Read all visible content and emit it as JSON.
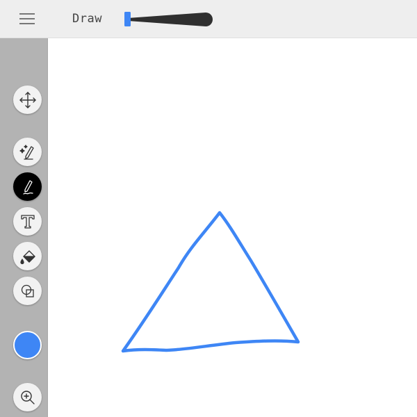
{
  "header": {
    "title": "Draw",
    "menu_icon": "hamburger-menu-icon",
    "brush_size_icon": "brush-size-slider"
  },
  "toolbar": {
    "tools": [
      {
        "name": "move",
        "icon": "move-arrows-icon",
        "active": false
      },
      {
        "name": "magic-pen",
        "icon": "magic-pen-icon",
        "active": false
      },
      {
        "name": "pen",
        "icon": "pen-icon",
        "active": true
      },
      {
        "name": "text",
        "icon": "text-icon",
        "active": false
      },
      {
        "name": "fill",
        "icon": "paint-bucket-icon",
        "active": false
      },
      {
        "name": "shapes",
        "icon": "shapes-icon",
        "active": false
      }
    ],
    "color": "#3e86f5",
    "zoom_icon": "zoom-in-icon"
  },
  "canvas": {
    "stroke_color": "#3e86f5",
    "shape": "hand-drawn triangle"
  },
  "colors": {
    "topbar": "#eeeeee",
    "sidebar": "#b3b3b3",
    "accent": "#3e86f5"
  }
}
